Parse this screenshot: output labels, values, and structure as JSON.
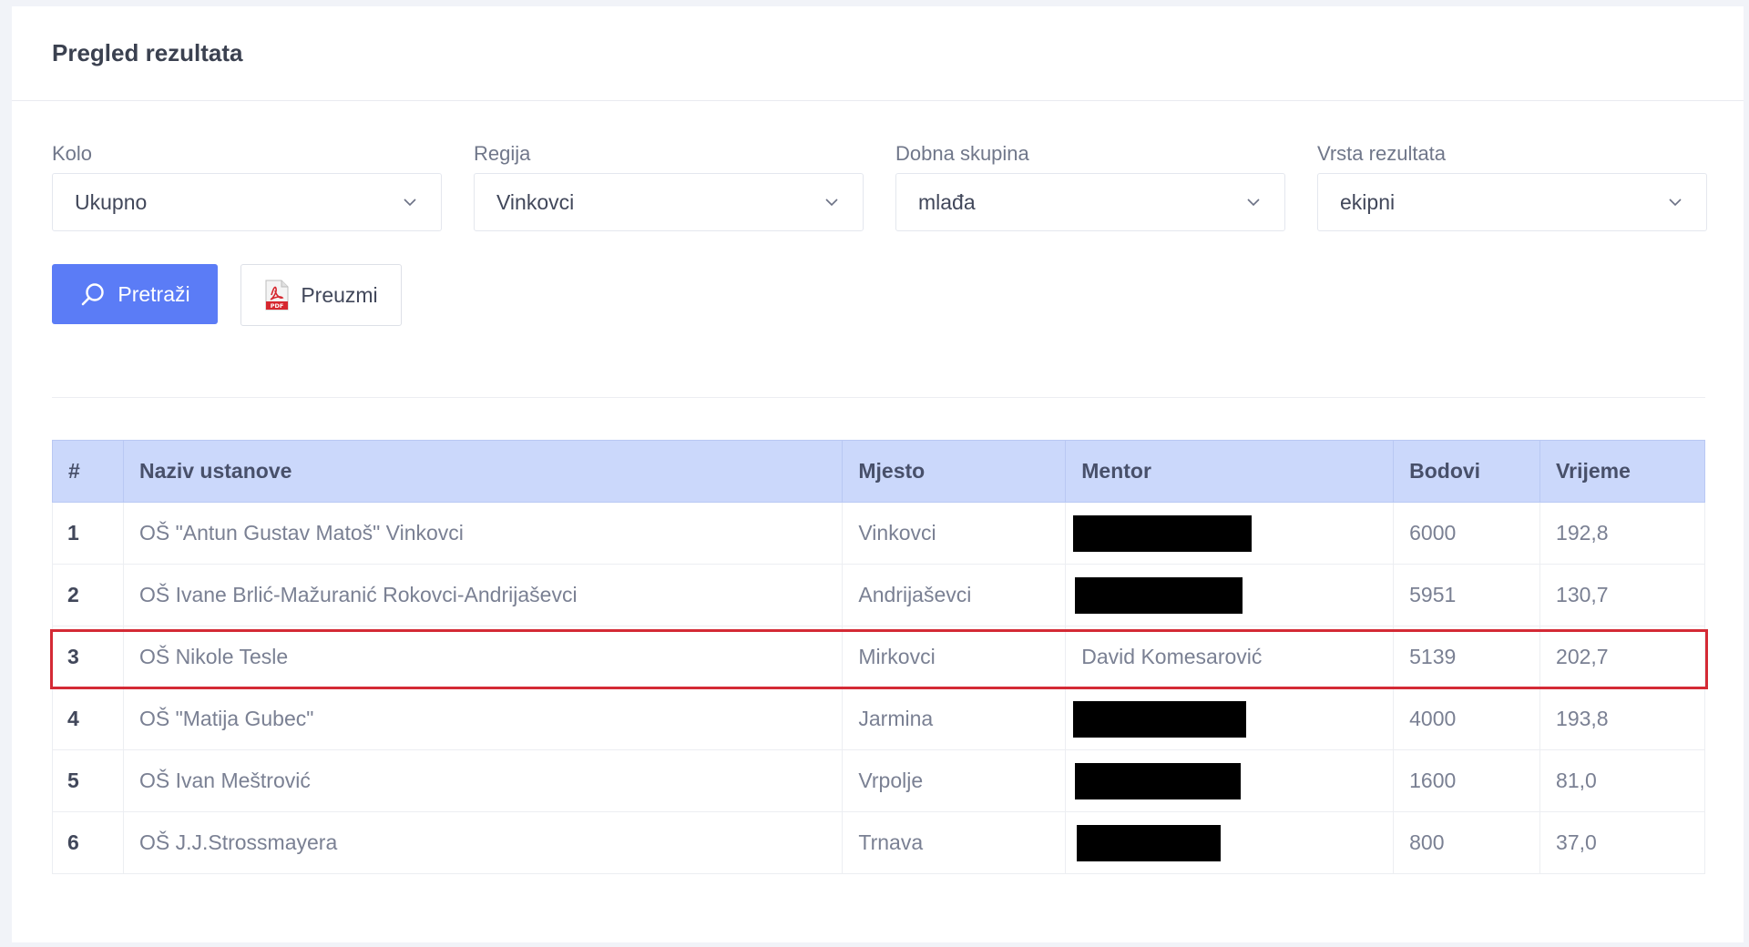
{
  "header": {
    "title": "Pregled rezultata"
  },
  "filters": [
    {
      "label": "Kolo",
      "value": "Ukupno"
    },
    {
      "label": "Regija",
      "value": "Vinkovci"
    },
    {
      "label": "Dobna skupina",
      "value": "mlađa"
    },
    {
      "label": "Vrsta rezultata",
      "value": "ekipni"
    }
  ],
  "actions": {
    "search_label": "Pretraži",
    "download_label": "Preuzmi",
    "pdf_icon_text": "PDF"
  },
  "table": {
    "columns": [
      "#",
      "Naziv ustanove",
      "Mjesto",
      "Mentor",
      "Bodovi",
      "Vrijeme"
    ],
    "rows": [
      {
        "rank": "1",
        "name": "OŠ \"Antun Gustav Matoš\" Vinkovci",
        "place": "Vinkovci",
        "mentor": "",
        "points": "6000",
        "time": "192,8"
      },
      {
        "rank": "2",
        "name": "OŠ Ivane Brlić-Mažuranić Rokovci-Andrijaševci",
        "place": "Andrijaševci",
        "mentor": "",
        "points": "5951",
        "time": "130,7"
      },
      {
        "rank": "3",
        "name": "OŠ Nikole Tesle",
        "place": "Mirkovci",
        "mentor": "David Komesarović",
        "points": "5139",
        "time": "202,7"
      },
      {
        "rank": "4",
        "name": "OŠ \"Matija Gubec\"",
        "place": "Jarmina",
        "mentor": "",
        "points": "4000",
        "time": "193,8"
      },
      {
        "rank": "5",
        "name": "OŠ Ivan Meštrović",
        "place": "Vrpolje",
        "mentor": "",
        "points": "1600",
        "time": "81,0"
      },
      {
        "rank": "6",
        "name": "OŠ J.J.Strossmayera",
        "place": "Trnava",
        "mentor": "",
        "points": "800",
        "time": "37,0"
      }
    ]
  },
  "colors": {
    "primary": "#5b7cf6",
    "header_bg": "#cbd8fb",
    "highlight": "#d42a35"
  }
}
